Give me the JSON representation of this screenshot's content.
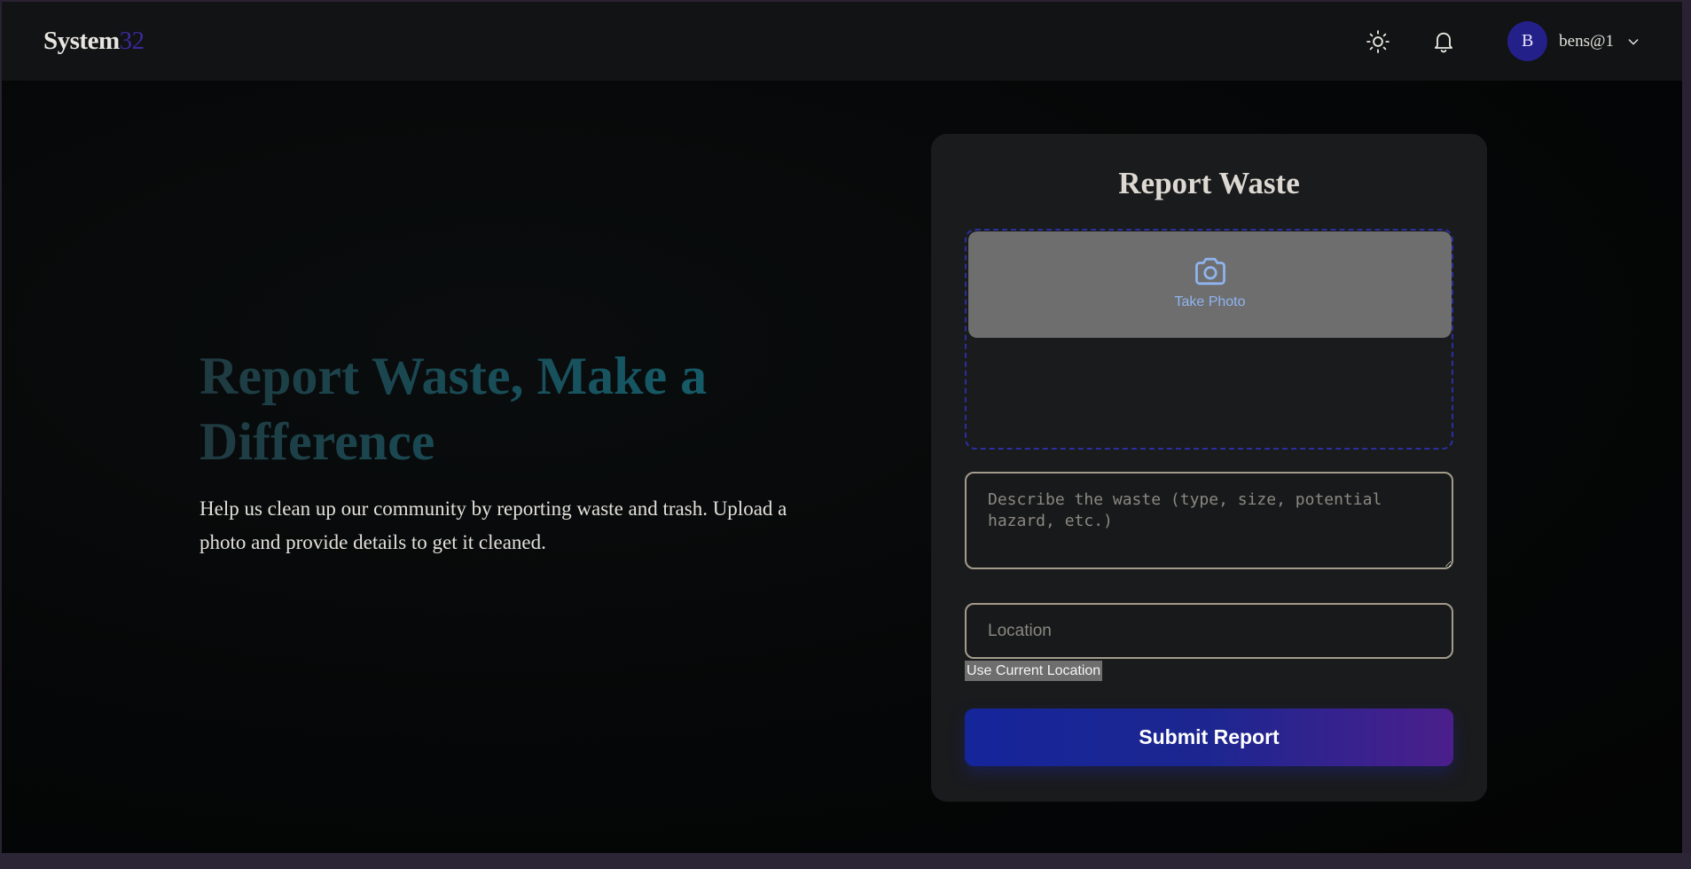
{
  "header": {
    "logo_main": "System",
    "logo_accent": "32",
    "avatar_initial": "B",
    "username": "bens@1"
  },
  "hero": {
    "title": "Report Waste, Make a Difference",
    "description": "Help us clean up our community by reporting waste and trash. Upload a photo and provide details to get it cleaned."
  },
  "form": {
    "title": "Report Waste",
    "photo_button_label": "Take Photo",
    "description_placeholder": "Describe the waste (type, size, potential hazard, etc.)",
    "location_placeholder": "Location",
    "use_location_label": "Use Current Location",
    "submit_label": "Submit Report"
  },
  "icons": {
    "theme": "sun-icon",
    "notifications": "bell-icon",
    "user_menu": "chevron-down-icon",
    "photo": "camera-icon"
  },
  "colors": {
    "logo_accent": "#3a2a9a",
    "avatar": "#24208a",
    "dropzone_border": "#2a2fa0",
    "photo_label": "#8fb4f0",
    "submit_start": "#15259a",
    "submit_end": "#4b1f8c"
  }
}
